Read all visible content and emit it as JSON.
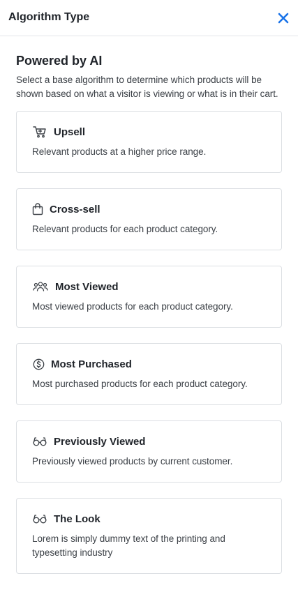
{
  "header": {
    "title": "Algorithm Type",
    "close_icon": "close-icon",
    "accent_color": "#1a73e8"
  },
  "section": {
    "title": "Powered by AI",
    "description": "Select a base algorithm to determine which products will be shown based on what a visitor is viewing or what is in their cart."
  },
  "options": [
    {
      "icon": "cart-icon",
      "title": "Upsell",
      "description": "Relevant products at a higher price range."
    },
    {
      "icon": "shopping-bag-icon",
      "title": "Cross-sell",
      "description": "Relevant products for each product category."
    },
    {
      "icon": "users-icon",
      "title": "Most Viewed",
      "description": "Most viewed products for each product category."
    },
    {
      "icon": "dollar-circle-icon",
      "title": "Most Purchased",
      "description": "Most purchased products for each product category."
    },
    {
      "icon": "glasses-icon",
      "title": "Previously Viewed",
      "description": "Previously viewed products by current customer."
    },
    {
      "icon": "glasses-icon",
      "title": "The Look",
      "description": "Lorem is simply dummy text of the printing and typesetting industry"
    }
  ]
}
